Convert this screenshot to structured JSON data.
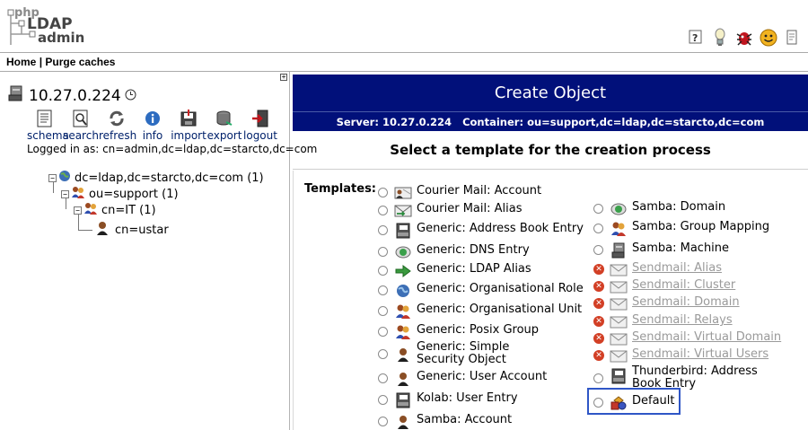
{
  "app": {
    "logo_text": [
      "php",
      "LDAP",
      "admin"
    ]
  },
  "top_icons": [
    "help-icon",
    "donate-icon",
    "bug-icon",
    "smiley-icon"
  ],
  "menubar": {
    "home": "Home",
    "separator": "|",
    "purge": "Purge caches"
  },
  "server": {
    "address": "10.27.0.224",
    "logged_in": "Logged in as: cn=admin,dc=ldap,dc=starcto,dc=com"
  },
  "tools": [
    {
      "label": "schema",
      "icon": "schema-icon"
    },
    {
      "label": "search",
      "icon": "search-icon"
    },
    {
      "label": "refresh",
      "icon": "refresh-icon"
    },
    {
      "label": "info",
      "icon": "info-icon"
    },
    {
      "label": "import",
      "icon": "import-icon"
    },
    {
      "label": "export",
      "icon": "export-icon"
    },
    {
      "label": "logout",
      "icon": "logout-icon"
    }
  ],
  "tree": {
    "root": "dc=ldap,dc=starcto,dc=com (1)",
    "ou": "ou=support (1)",
    "cn_group": "cn=IT (1)",
    "leaf": "cn=ustar"
  },
  "create": {
    "title": "Create Object",
    "server_label": "Server:",
    "server_value": "10.27.0.224",
    "container_label": "Container:",
    "container_value": "ou=support,dc=ldap,dc=starcto,dc=com",
    "instruction": "Select a template for the creation process",
    "templates_label": "Templates:"
  },
  "templates_left": [
    "Courier Mail: Account",
    "Courier Mail: Alias",
    "Generic: Address Book Entry",
    "Generic: DNS Entry",
    "Generic: LDAP Alias",
    "Generic: Organisational Role",
    "Generic: Organisational Unit",
    "Generic: Posix Group",
    "Generic: Simple Security Object",
    "Generic: User Account",
    "Kolab: User Entry",
    "Samba: Account"
  ],
  "templates_right": [
    "Samba: Domain",
    "Samba: Group Mapping",
    "Samba: Machine",
    "Sendmail: Alias",
    "Sendmail: Cluster",
    "Sendmail: Domain",
    "Sendmail: Relays",
    "Sendmail: Virtual Domain",
    "Sendmail: Virtual Users",
    "Thunderbird: Address Book Entry",
    "Default"
  ],
  "colors": {
    "title_bar": "#01107a",
    "highlight": "#2f56c6",
    "disabled_text": "#9a9a9a"
  }
}
